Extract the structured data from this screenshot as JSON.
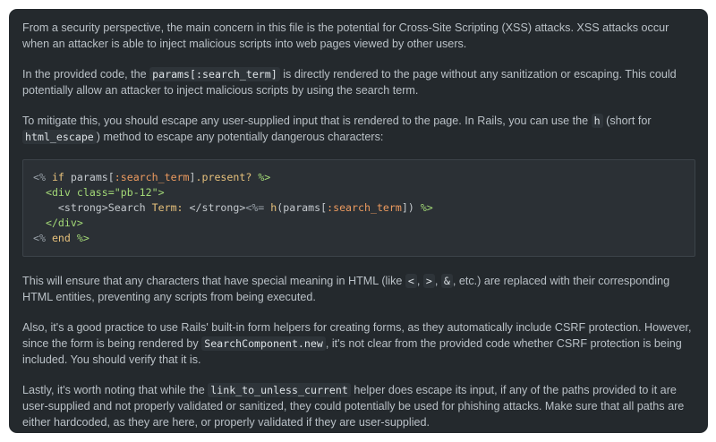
{
  "message": {
    "p1": "From a security perspective, the main concern in this file is the potential for Cross-Site Scripting (XSS) attacks. XSS attacks occur when an attacker is able to inject malicious scripts into web pages viewed by other users.",
    "p2": {
      "a": "In the provided code, the ",
      "code": "params[:search_term]",
      "b": " is directly rendered to the page without any sanitization or escaping. This could potentially allow an attacker to inject malicious scripts by using the search term."
    },
    "p3": {
      "a": "To mitigate this, you should escape any user-supplied input that is rendered to the page. In Rails, you can use the ",
      "code1": "h",
      "b": " (short for ",
      "code2": "html_escape",
      "c": ") method to escape any potentially dangerous characters:"
    },
    "code_block": {
      "line1": {
        "open": "<%",
        "kw": "if",
        "a": " params[",
        "sym": ":search_term",
        "b": "]",
        "method": ".present?",
        "close": "%>"
      },
      "line2": {
        "indent": "  ",
        "tag_open": "<div",
        "attr": " class=",
        "str": "\"pb-12\"",
        "tag_close": ">"
      },
      "line3": {
        "indent": "    ",
        "a": "<strong>Search ",
        "label": "Term:",
        "b": " </strong>",
        "open": "<%=",
        "method": "h",
        "c": "(params[",
        "sym": ":search_term",
        "d": "])",
        "close": "%>"
      },
      "line4": {
        "indent": "  ",
        "tag": "</div>"
      },
      "line5": {
        "open": "<%",
        "kw": "end",
        "close": "%>"
      }
    },
    "p4": {
      "a": "This will ensure that any characters that have special meaning in HTML (like ",
      "c1": "<",
      "s1": ", ",
      "c2": ">",
      "s2": ", ",
      "c3": "&",
      "b": ", etc.) are replaced with their corresponding HTML entities, preventing any scripts from being executed."
    },
    "p5": {
      "a": "Also, it's a good practice to use Rails' built-in form helpers for creating forms, as they automatically include CSRF protection. However, since the form is being rendered by ",
      "code": "SearchComponent.new",
      "b": ", it's not clear from the provided code whether CSRF protection is being included. You should verify that it is."
    },
    "p6": {
      "a": "Lastly, it's worth noting that while the ",
      "code": "link_to_unless_current",
      "b": " helper does escape its input, if any of the paths provided to it are user-supplied and not properly validated or sanitized, they could potentially be used for phishing attacks. Make sure that all paths are either hardcoded, as they are here, or properly validated if they are user-supplied."
    }
  }
}
